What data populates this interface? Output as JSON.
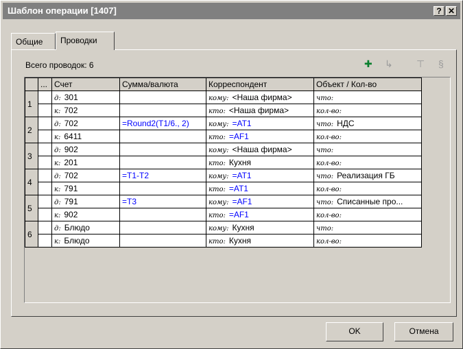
{
  "window": {
    "title": "Шаблон операции [1407]",
    "help_label": "?",
    "close_label": "✕"
  },
  "tabs": [
    {
      "label": "Общие"
    },
    {
      "label": "Проводки"
    }
  ],
  "summary": {
    "count_label": "Всего проводок: 6"
  },
  "toolbar": {
    "icons": [
      "add-entry-icon",
      "edit-entry-icon",
      "filter-icon",
      "link-icon"
    ]
  },
  "grid": {
    "headers": [
      "...",
      "Счет",
      "Сумма/валюта",
      "Корреспондент",
      "Объект / Кол-во"
    ],
    "entries": [
      {
        "num": "1",
        "d": {
          "prefix": "д:",
          "account": "301",
          "sum": "",
          "corr_prefix": "кому:",
          "corr": "<Наша фирма>",
          "obj_prefix": "что:",
          "obj": ""
        },
        "k": {
          "prefix": "к:",
          "account": "702",
          "sum": "",
          "corr_prefix": "кто:",
          "corr": "<Наша фирма>",
          "obj_prefix": "кол-во:",
          "obj": ""
        }
      },
      {
        "num": "2",
        "d": {
          "prefix": "д:",
          "account": "702",
          "sum": "=Round2(T1/6., 2)",
          "corr_prefix": "кому:",
          "corr": "=AT1",
          "obj_prefix": "что:",
          "obj": "НДС"
        },
        "k": {
          "prefix": "к:",
          "account": "6411",
          "sum": "",
          "corr_prefix": "кто:",
          "corr": "=AF1",
          "obj_prefix": "кол-во:",
          "obj": ""
        }
      },
      {
        "num": "3",
        "d": {
          "prefix": "д:",
          "account": "902",
          "sum": "",
          "corr_prefix": "кому:",
          "corr": "<Наша фирма>",
          "obj_prefix": "что:",
          "obj": ""
        },
        "k": {
          "prefix": "к:",
          "account": "201",
          "sum": "",
          "corr_prefix": "кто:",
          "corr": "Кухня",
          "obj_prefix": "кол-во:",
          "obj": ""
        }
      },
      {
        "num": "4",
        "d": {
          "prefix": "д:",
          "account": "702",
          "sum": "=T1-T2",
          "corr_prefix": "кому:",
          "corr": "=AT1",
          "obj_prefix": "что:",
          "obj": "Реализация ГБ"
        },
        "k": {
          "prefix": "к:",
          "account": "791",
          "sum": "",
          "corr_prefix": "кто:",
          "corr": "=AT1",
          "obj_prefix": "кол-во:",
          "obj": ""
        }
      },
      {
        "num": "5",
        "d": {
          "prefix": "д:",
          "account": "791",
          "sum": "=T3",
          "corr_prefix": "кому:",
          "corr": "=AF1",
          "obj_prefix": "что:",
          "obj": "Списанные про..."
        },
        "k": {
          "prefix": "к:",
          "account": "902",
          "sum": "",
          "corr_prefix": "кто:",
          "corr": "=AF1",
          "obj_prefix": "кол-во:",
          "obj": ""
        }
      },
      {
        "num": "6",
        "d": {
          "prefix": "д:",
          "account": "Блюдо",
          "sum": "",
          "corr_prefix": "кому:",
          "corr": "Кухня",
          "obj_prefix": "что:",
          "obj": ""
        },
        "k": {
          "prefix": "к:",
          "account": "Блюдо",
          "sum": "",
          "corr_prefix": "кто:",
          "corr": "Кухня",
          "obj_prefix": "кол-во:",
          "obj": ""
        }
      }
    ]
  },
  "buttons": {
    "ok": "OK",
    "cancel": "Отмена"
  }
}
